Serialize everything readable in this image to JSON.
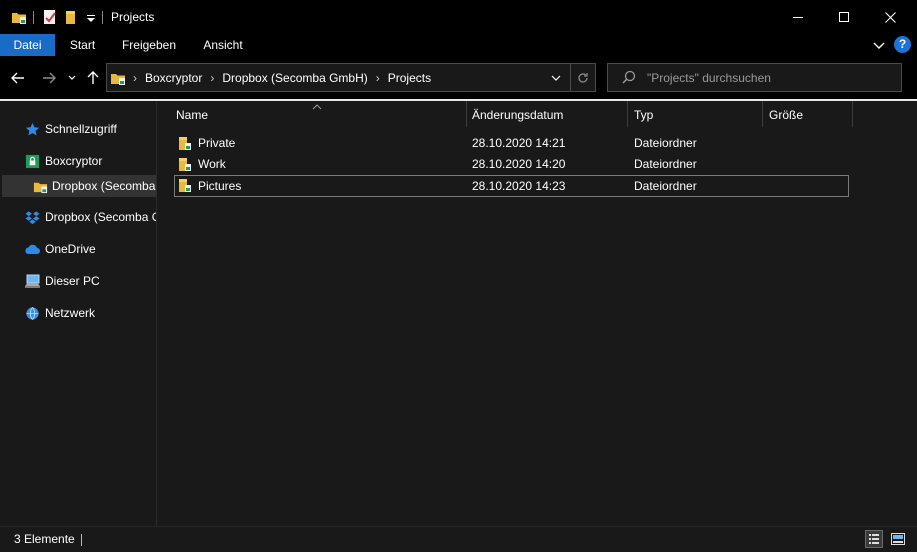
{
  "window": {
    "title": "Projects"
  },
  "ribbon": {
    "tabs": [
      "Datei",
      "Start",
      "Freigeben",
      "Ansicht"
    ],
    "help_label": "?"
  },
  "address_bar": {
    "breadcrumbs": [
      "Boxcryptor",
      "Dropbox (Secomba GmbH)",
      "Projects"
    ]
  },
  "search": {
    "placeholder": "\"Projects\" durchsuchen"
  },
  "sidebar": {
    "items": [
      {
        "label": "Schnellzugriff",
        "icon": "star-icon"
      },
      {
        "label": "Boxcryptor",
        "icon": "boxcryptor-icon"
      },
      {
        "label": "Dropbox (Secomba GmbH)",
        "icon": "encrypted-folder-icon"
      },
      {
        "label": "Dropbox (Secomba GmbH)",
        "icon": "dropbox-icon"
      },
      {
        "label": "OneDrive",
        "icon": "cloud-icon"
      },
      {
        "label": "Dieser PC",
        "icon": "computer-icon"
      },
      {
        "label": "Netzwerk",
        "icon": "network-icon"
      }
    ]
  },
  "file_list": {
    "columns": [
      "Name",
      "Änderungsdatum",
      "Typ",
      "Größe"
    ],
    "rows": [
      {
        "name": "Private",
        "date": "28.10.2020 14:21",
        "type": "Dateiordner",
        "size": ""
      },
      {
        "name": "Work",
        "date": "28.10.2020 14:20",
        "type": "Dateiordner",
        "size": ""
      },
      {
        "name": "Pictures",
        "date": "28.10.2020 14:23",
        "type": "Dateiordner",
        "size": ""
      }
    ]
  },
  "status": {
    "item_count": "3 Elemente"
  },
  "colors": {
    "accent": "#1a6bc7",
    "folder": "#e8b93d",
    "boxcryptor_green": "#1e9e54"
  }
}
